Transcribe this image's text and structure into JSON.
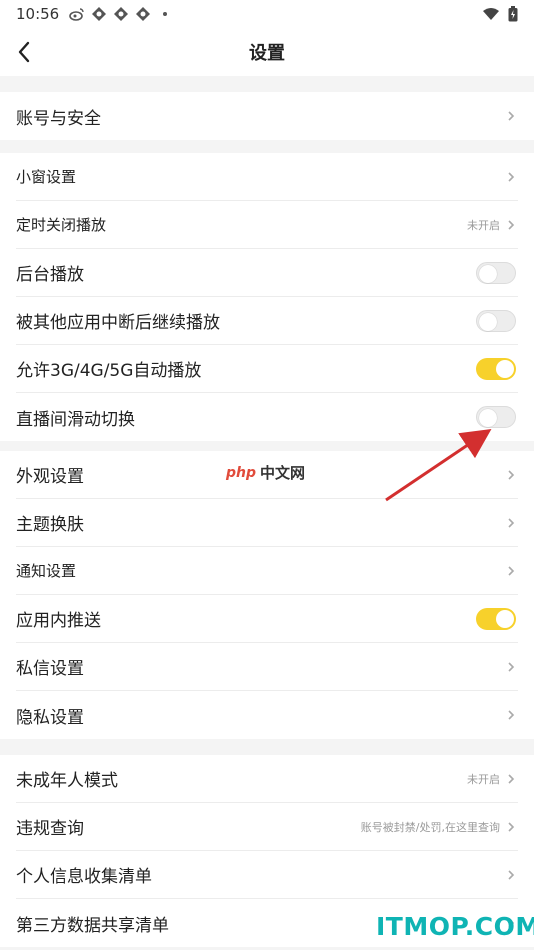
{
  "statusbar": {
    "time": "10:56"
  },
  "header": {
    "title": "设置"
  },
  "groups": [
    {
      "rows": [
        {
          "label": "账号与安全",
          "type": "chevron"
        }
      ]
    },
    {
      "rows": [
        {
          "label": "小窗设置",
          "type": "chevron"
        },
        {
          "label": "定时关闭播放",
          "sub": "未开启",
          "type": "chevron"
        },
        {
          "label": "后台播放",
          "type": "toggle",
          "on": false
        },
        {
          "label": "被其他应用中断后继续播放",
          "type": "toggle",
          "on": false
        },
        {
          "label": "允许3G/4G/5G自动播放",
          "type": "toggle",
          "on": true
        },
        {
          "label": "直播间滑动切换",
          "type": "toggle",
          "on": false
        }
      ]
    },
    {
      "rows": [
        {
          "label": "外观设置",
          "type": "chevron"
        },
        {
          "label": "主题换肤",
          "type": "chevron"
        },
        {
          "label": "通知设置",
          "type": "chevron"
        },
        {
          "label": "应用内推送",
          "type": "toggle",
          "on": true
        },
        {
          "label": "私信设置",
          "type": "chevron"
        },
        {
          "label": "隐私设置",
          "type": "chevron"
        }
      ]
    },
    {
      "rows": [
        {
          "label": "未成年人模式",
          "sub": "未开启",
          "type": "chevron"
        },
        {
          "label": "违规查询",
          "sub": "账号被封禁/处罚,在这里查询",
          "type": "chevron"
        },
        {
          "label": "个人信息收集清单",
          "type": "chevron"
        },
        {
          "label": "第三方数据共享清单",
          "type": "chevron"
        }
      ]
    }
  ],
  "watermark": {
    "php": "php",
    "cn": "中文网"
  },
  "site_watermark": "ITMOP.COM",
  "colors": {
    "toggle_on": "#f7d12b",
    "arrow": "#d32f2f",
    "itmop": "#0fb4b4"
  }
}
